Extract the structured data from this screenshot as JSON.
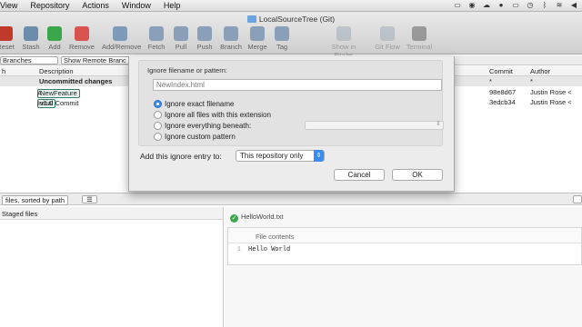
{
  "menubar": {
    "items": [
      "View",
      "Repository",
      "Actions",
      "Window",
      "Help"
    ]
  },
  "window": {
    "title": "LocalSourceTree (Git)"
  },
  "toolbar": [
    {
      "label": "Reset",
      "color": "#c0392b"
    },
    {
      "label": "Stash",
      "color": "#6c8cab"
    },
    {
      "label": "Add",
      "color": "#3aa84a"
    },
    {
      "label": "Remove",
      "color": "#d9534f"
    },
    {
      "label": "Add/Remove",
      "color": "#7d9ab8"
    },
    {
      "label": "Fetch",
      "color": "#8aa0b8"
    },
    {
      "label": "Pull",
      "color": "#8aa0b8"
    },
    {
      "label": "Push",
      "color": "#8aa0b8"
    },
    {
      "label": "Branch",
      "color": "#8aa0b8"
    },
    {
      "label": "Merge",
      "color": "#8aa0b8"
    },
    {
      "label": "Tag",
      "color": "#8aa0b8"
    },
    {
      "label": "Show in Finder",
      "color": "#9aa7b5"
    },
    {
      "label": "Git Flow",
      "color": "#9aa7b5"
    },
    {
      "label": "Terminal",
      "color": "#555"
    }
  ],
  "branch_bar": {
    "branches_select": "Branches",
    "remote_select": "Show Remote Branc"
  },
  "columns": {
    "graph": "h",
    "description": "Description",
    "commit": "Commit",
    "author": "Author"
  },
  "commits": [
    {
      "description": "Uncommitted changes",
      "commit": "*",
      "author": "*"
    },
    {
      "tags": [
        "master",
        "NewFeature"
      ],
      "description": "A",
      "commit": "98e8d67",
      "author": "Justin Rose <"
    },
    {
      "tags": [
        "v1.0"
      ],
      "description": "Initial Commit",
      "commit": "3edcb34",
      "author": "Justin Rose <"
    }
  ],
  "sort_bar": {
    "label": "files, sorted by path"
  },
  "staged": {
    "header": "Staged files"
  },
  "diff": {
    "file_name": "HelloWorld.txt",
    "header": "File contents",
    "line_number": "1",
    "line_text": "Hello World"
  },
  "dialog": {
    "label": "Ignore filename or pattern:",
    "pattern_placeholder": "NewIndex.html",
    "options": [
      "Ignore exact filename",
      "Ignore all files with this extension",
      "Ignore everything beneath:",
      "Ignore custom pattern"
    ],
    "selected_option": 0,
    "entry_label": "Add this ignore entry to:",
    "entry_value": "This repository only",
    "cancel": "Cancel",
    "ok": "OK"
  }
}
